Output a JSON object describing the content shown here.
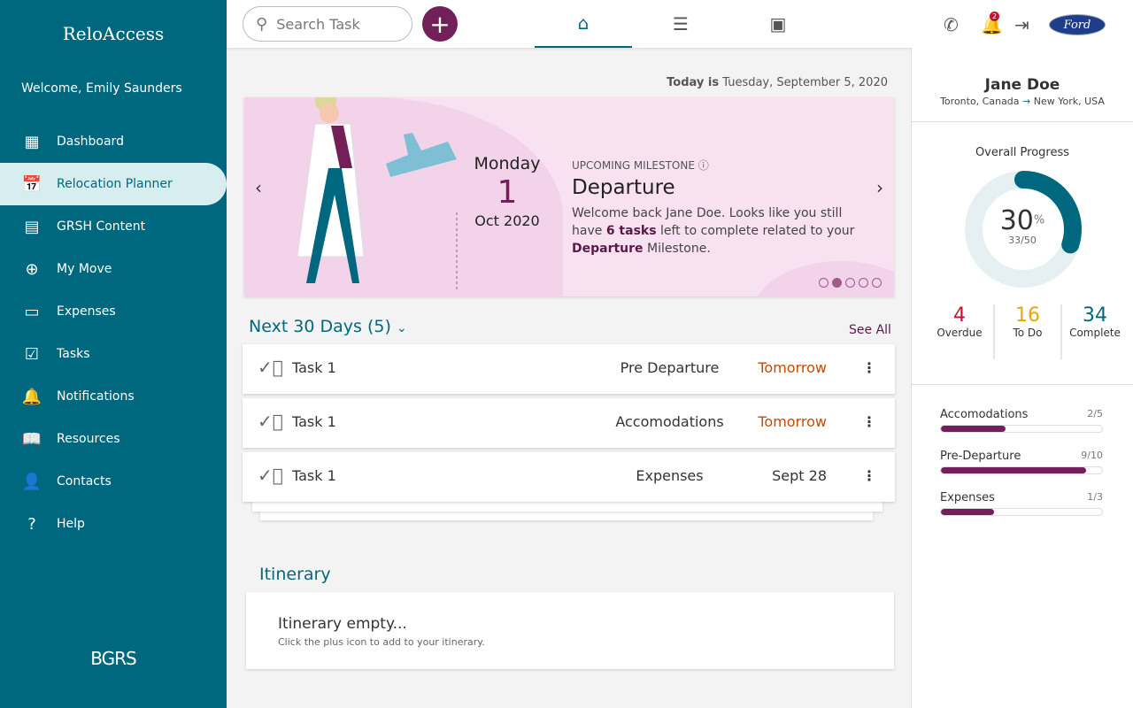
{
  "app": {
    "title": "ReloAccess",
    "welcome": "Welcome, Emily Saunders",
    "footer_logo": "BGRS"
  },
  "sidebar": {
    "items": [
      {
        "label": "Dashboard",
        "icon": "dashboard-icon",
        "glyph": "▦"
      },
      {
        "label": "Relocation Planner",
        "icon": "calendar-plane-icon",
        "glyph": "📅",
        "active": true
      },
      {
        "label": "GRSH Content",
        "icon": "article-icon",
        "glyph": "▤"
      },
      {
        "label": "My Move",
        "icon": "globe-icon",
        "glyph": "⊕"
      },
      {
        "label": "Expenses",
        "icon": "credit-card-icon",
        "glyph": "▭"
      },
      {
        "label": "Tasks",
        "icon": "clipboard-check-icon",
        "glyph": "☑"
      },
      {
        "label": "Notifications",
        "icon": "bell-icon",
        "glyph": "🔔"
      },
      {
        "label": "Resources",
        "icon": "book-icon",
        "glyph": "📖"
      },
      {
        "label": "Contacts",
        "icon": "contact-icon",
        "glyph": "👤"
      },
      {
        "label": "Help",
        "icon": "help-icon",
        "glyph": "?"
      }
    ]
  },
  "topbar": {
    "search_placeholder": "Search Task",
    "notification_count": "2",
    "brand": "Ford"
  },
  "main": {
    "today_label": "Today is",
    "today": "Tuesday, September 5, 2020",
    "hero": {
      "weekday": "Monday",
      "day": "1",
      "month_year": "Oct 2020",
      "label": "UPCOMING MILESTONE",
      "title": "Departure",
      "text1": "Welcome back Jane Doe. Looks like you still have",
      "count": "6 tasks",
      "text2": "left to complete related to your",
      "milestone": "Departure",
      "text3": "Milestone.",
      "active_slide": 2,
      "slides": 5
    },
    "next_title": "Next 30 Days (5)",
    "see_all": "See All",
    "tasks": [
      {
        "name": "Task 1",
        "category": "Pre Departure",
        "due": "Tomorrow",
        "urgent": true
      },
      {
        "name": "Task 1",
        "category": "Accomodations",
        "due": "Tomorrow",
        "urgent": true
      },
      {
        "name": "Task 1",
        "category": "Expenses",
        "due": "Sept 28",
        "urgent": false
      }
    ],
    "itinerary": {
      "title": "Itinerary",
      "empty_title": "Itinerary empty...",
      "empty_text": "Click the plus icon to add to your itinerary."
    }
  },
  "profile": {
    "name": "Jane Doe",
    "from": "Toronto, Canada",
    "to": "New York, USA",
    "progress_title": "Overall Progress",
    "percent": 30,
    "percent_label": "30",
    "percent_sign": "%",
    "fraction": "33/50",
    "stats": [
      {
        "value": "4",
        "label": "Overdue",
        "color": "#c8102e"
      },
      {
        "value": "16",
        "label": "To Do",
        "color": "#e8a800"
      },
      {
        "value": "34",
        "label": "Complete",
        "color": "#00687e"
      }
    ],
    "categories": [
      {
        "name": "Accomodations",
        "count": "2/5",
        "fraction": 0.4
      },
      {
        "name": "Pre-Departure",
        "count": "9/10",
        "fraction": 0.9
      },
      {
        "name": "Expenses",
        "count": "1/3",
        "fraction": 0.33
      }
    ]
  }
}
